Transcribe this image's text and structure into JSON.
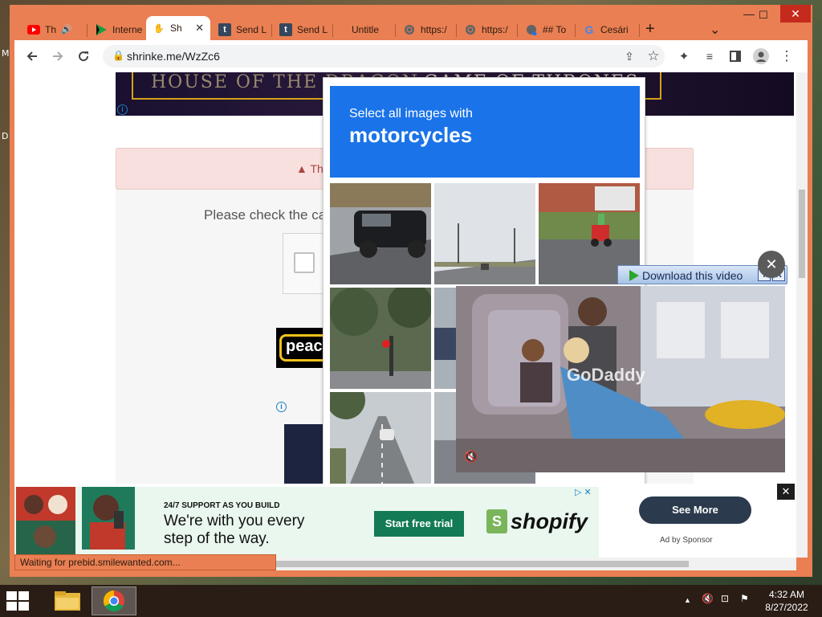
{
  "desktop": {
    "left_fragments": [
      "M",
      "D"
    ]
  },
  "window": {
    "minimize": "—",
    "maximize": "☐",
    "close": "✕"
  },
  "tabs": [
    {
      "title": "Th",
      "icon": "youtube-icon"
    },
    {
      "title": "Interne",
      "icon": "play-icon"
    },
    {
      "title": "Sh",
      "icon": "hand-icon",
      "active": true
    },
    {
      "title": "Send L",
      "icon": "tumblr-icon"
    },
    {
      "title": "Send L",
      "icon": "tumblr-icon"
    },
    {
      "title": "Untitle",
      "icon": "none"
    },
    {
      "title": "https:/",
      "icon": "globe-icon"
    },
    {
      "title": "https:/",
      "icon": "globe-icon"
    },
    {
      "title": "## To",
      "icon": "globe-icon"
    },
    {
      "title": "Cesári",
      "icon": "google-icon"
    }
  ],
  "toolbar": {
    "url": "shrinke.me/WzZc6",
    "new_tab": "+",
    "tab_search": "⌄"
  },
  "page": {
    "banner_left": "HOUSE OF THE DRAGON",
    "banner_right": "GAME OF THRONES",
    "alert_text": "Th",
    "prompt": "Please check the ca",
    "peacock_text": "peac"
  },
  "captcha": {
    "line1": "Select all images with",
    "line2": "motorcycles"
  },
  "video_overlay": {
    "download_label": "Download this video",
    "help": "?",
    "close": "X",
    "overlay_close": "✕",
    "watermark": "GoDaddy",
    "mute": "🔇"
  },
  "bottom_ad": {
    "tagline": "24/7 SUPPORT AS YOU BUILD",
    "headline": "We're with you every step of the way.",
    "cta": "Start free trial",
    "brand": "shopify",
    "see_more": "See More",
    "sponsor": "Ad by Sponsor",
    "markers": "▷ ✕",
    "close": "✕"
  },
  "status_text": "Waiting for prebid.smilewanted.com...",
  "taskbar": {
    "time": "4:32 AM",
    "date": "8/27/2022",
    "tray_up": "▲",
    "tray_items": [
      "🔇",
      "⊡",
      "⚑"
    ]
  },
  "colors": {
    "chrome_frame": "#e97f52",
    "captcha_blue": "#1a73e8",
    "shopify_green": "#127a54"
  }
}
